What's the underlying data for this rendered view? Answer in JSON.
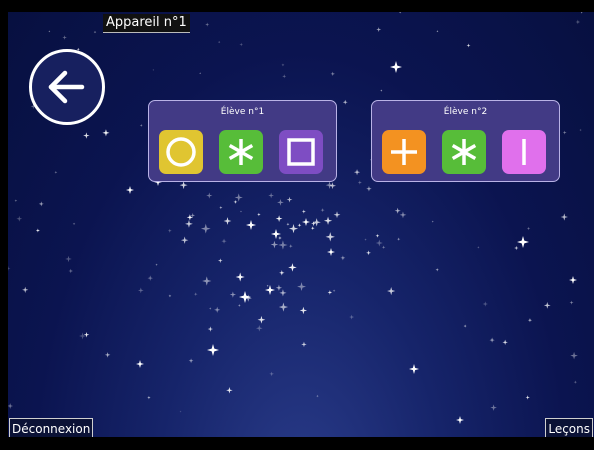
{
  "device_label": "Appareil n°1",
  "back_button": {
    "icon": "arrow-left-icon"
  },
  "students": [
    {
      "label": "Élève n°1",
      "symbols": [
        {
          "icon": "circle-icon",
          "color": "#e0c531"
        },
        {
          "icon": "asterisk-icon",
          "color": "#57bd39"
        },
        {
          "icon": "square-icon",
          "color": "#7e4dc3"
        }
      ]
    },
    {
      "label": "Élève n°2",
      "symbols": [
        {
          "icon": "plus-icon",
          "color": "#f39221"
        },
        {
          "icon": "asterisk-icon",
          "color": "#57bd39"
        },
        {
          "icon": "vertical-bar-icon",
          "color": "#e070ec"
        }
      ]
    }
  ],
  "footer": {
    "logout_label": "Déconnexion",
    "lessons_label": "Leçons"
  }
}
